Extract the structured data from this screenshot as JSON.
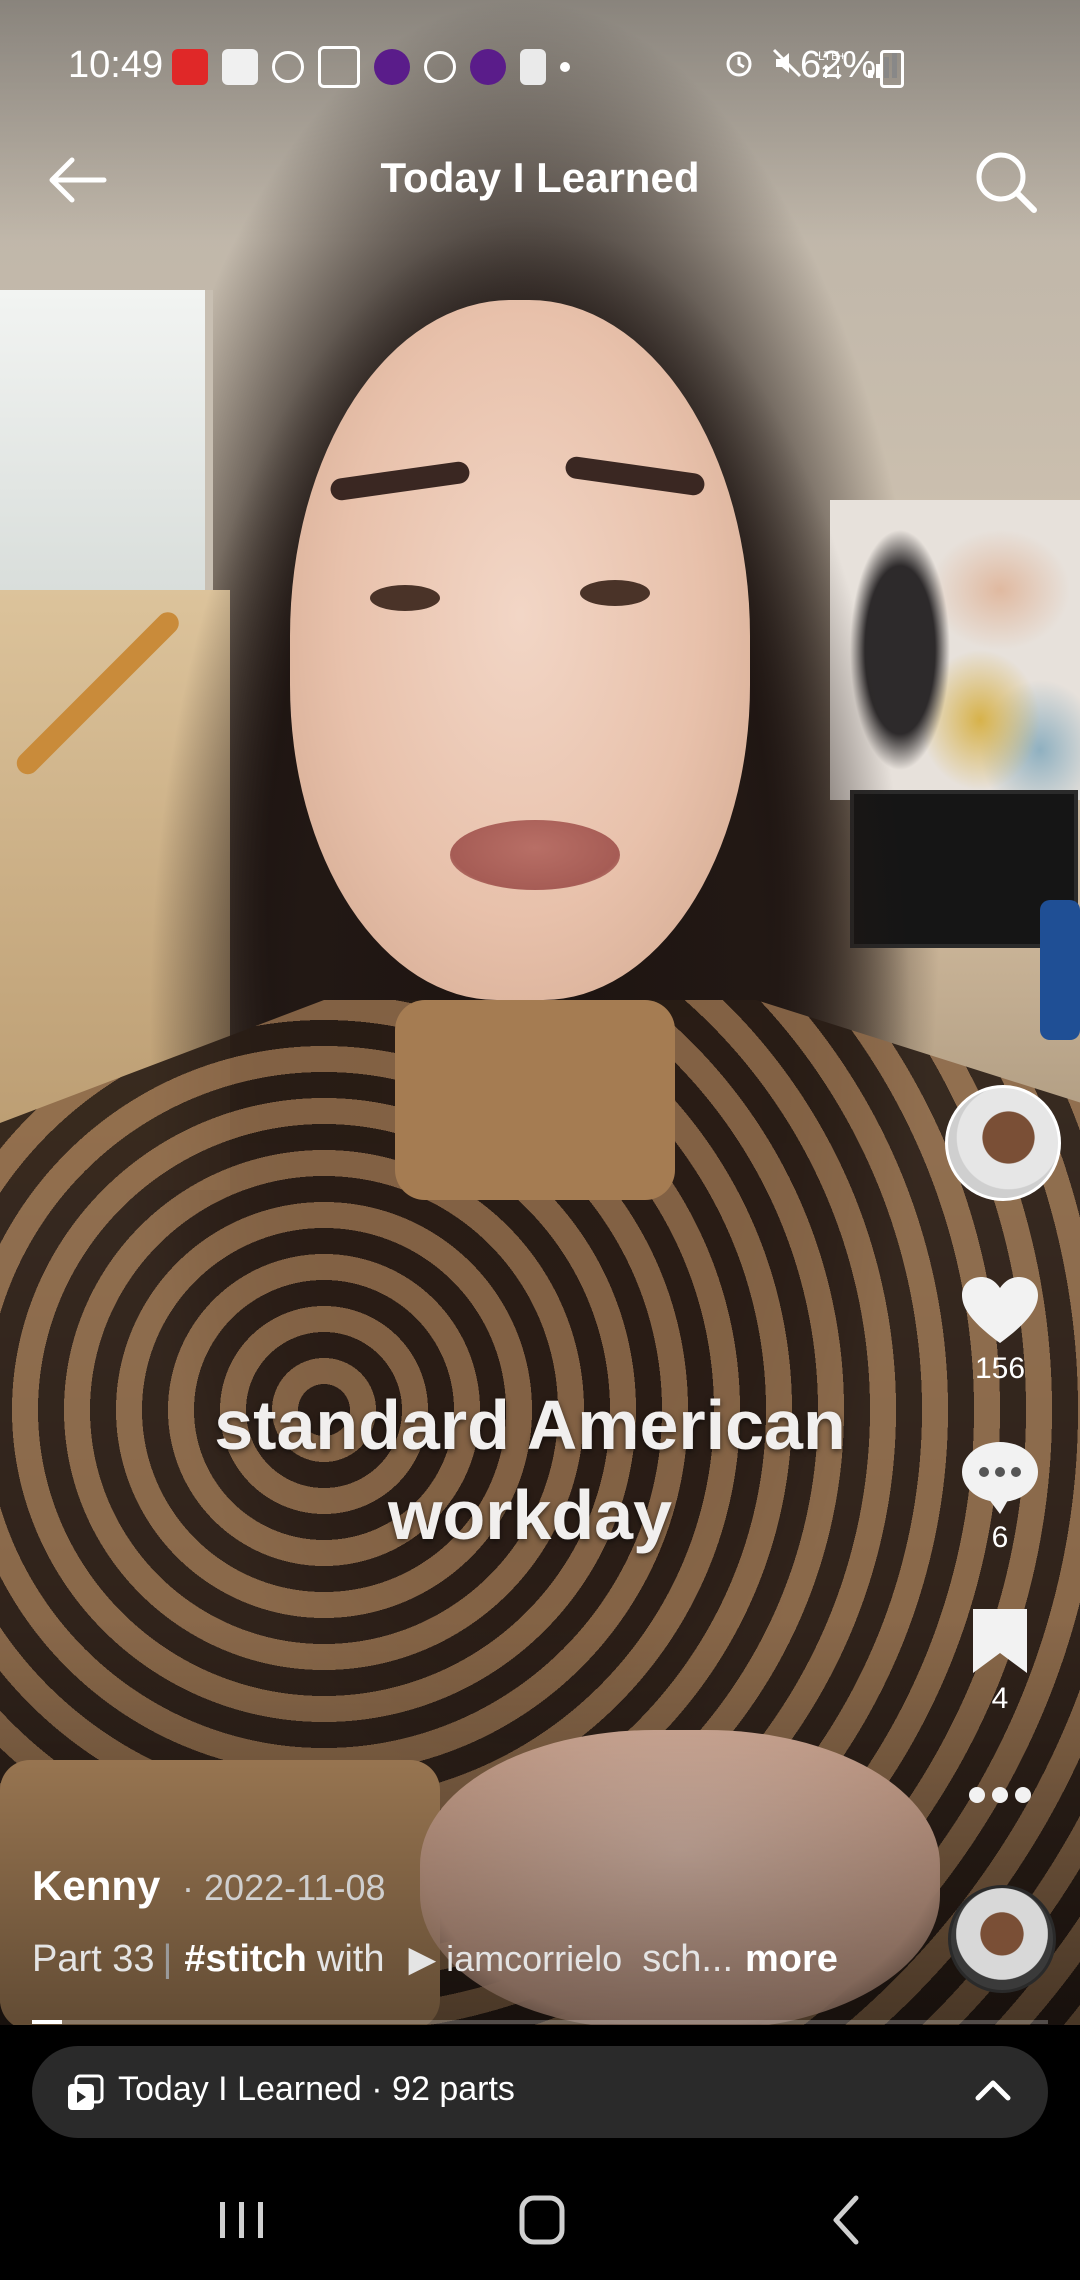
{
  "status_bar": {
    "time": "10:49",
    "battery": "62%"
  },
  "header": {
    "title": "Today I Learned",
    "back_icon": "arrow-left-icon",
    "search_icon": "search-icon"
  },
  "video": {
    "caption_line1": "standard American",
    "caption_line2": "workday",
    "progress": 0.03
  },
  "actions": {
    "likes": "156",
    "comments": "6",
    "saves": "4"
  },
  "info": {
    "author": "Kenny",
    "date": "· 2022-11-08",
    "part": "Part 33",
    "separator": "|",
    "hashtag": "#stitch",
    "with": "with",
    "mention": "▶ iamcorrielo",
    "truncated": "sch...",
    "more": "more"
  },
  "playlist": {
    "label": "Today I Learned · 92 parts"
  },
  "colors": {
    "accent": "#ffffff",
    "playlist_bg": "#2a2a2a"
  }
}
